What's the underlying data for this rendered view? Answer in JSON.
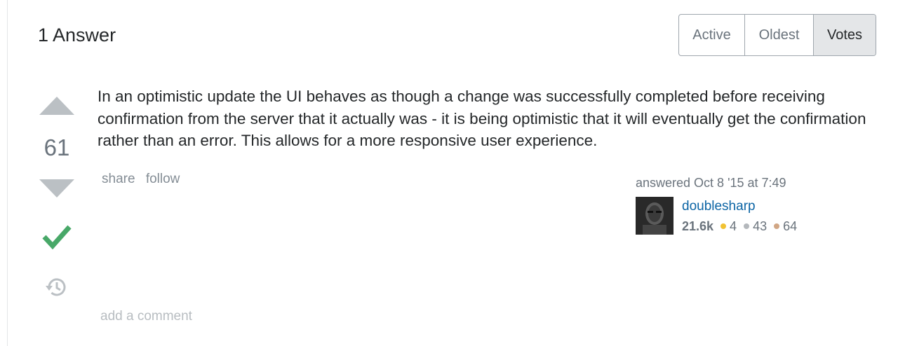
{
  "header": {
    "answer_count_title": "1 Answer"
  },
  "sort_tabs": [
    {
      "label": "Active",
      "selected": false
    },
    {
      "label": "Oldest",
      "selected": false
    },
    {
      "label": "Votes",
      "selected": true
    }
  ],
  "answer": {
    "vote_count": "61",
    "accepted": true,
    "body": "In an optimistic update the UI behaves as though a change was successfully completed before receiving confirmation from the server that it actually was - it is being optimistic that it will eventually get the confirmation rather than an error. This allows for a more responsive user experience.",
    "menu": {
      "share_label": "share",
      "follow_label": "follow"
    },
    "author": {
      "action_text": "answered Oct 8 '15 at 7:49",
      "name": "doublesharp",
      "reputation": "21.6k",
      "gold_badges": "4",
      "silver_badges": "43",
      "bronze_badges": "64"
    },
    "add_comment_label": "add a comment"
  },
  "colors": {
    "accepted_check": "#48a868",
    "vote_arrow": "#bbc0c4",
    "link_blue": "#0c65a5",
    "gold": "#f1c232",
    "silver": "#b4b8bc",
    "bronze": "#d1a684"
  },
  "icons": {
    "upvote": "arrow-up-icon",
    "downvote": "arrow-down-icon",
    "accepted": "check-icon",
    "history": "history-icon"
  }
}
